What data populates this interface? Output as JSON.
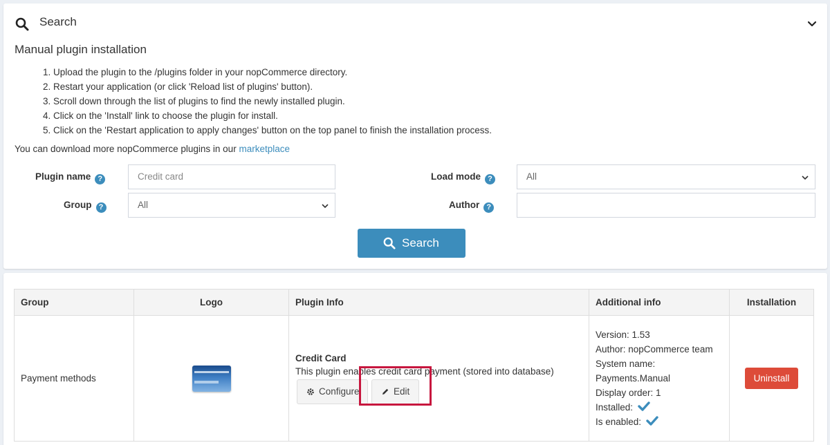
{
  "search_panel": {
    "title": "Search",
    "manual_title": "Manual plugin installation",
    "steps": [
      "1. Upload the plugin to the /plugins folder in your nopCommerce directory.",
      "2. Restart your application (or click 'Reload list of plugins' button).",
      "3. Scroll down through the list of plugins to find the newly installed plugin.",
      "4. Click on the 'Install' link to choose the plugin for install.",
      "5. Click on the 'Restart application to apply changes' button on the top panel to finish the installation process."
    ],
    "download_text": "You can download more nopCommerce plugins in our ",
    "download_link": "marketplace",
    "fields": {
      "plugin_name_label": "Plugin name",
      "plugin_name_placeholder": "Credit card",
      "group_label": "Group",
      "group_value": "All",
      "load_mode_label": "Load mode",
      "load_mode_value": "All",
      "author_label": "Author",
      "author_value": ""
    },
    "search_button": "Search"
  },
  "table": {
    "headers": [
      "Group",
      "Logo",
      "Plugin Info",
      "Additional info",
      "Installation"
    ],
    "row": {
      "group": "Payment methods",
      "plugin_name": "Credit Card",
      "plugin_desc": "This plugin enables credit card payment (stored into database)",
      "configure_button": "Configure",
      "edit_button": "Edit",
      "version": "Version: 1.53",
      "author": "Author: nopCommerce team",
      "system_name_label": "System name:",
      "system_name": "Payments.Manual",
      "display_order": "Display order: 1",
      "installed": "Installed:",
      "is_enabled": "Is enabled:",
      "uninstall_button": "Uninstall"
    }
  },
  "colors": {
    "accent": "#3c8dbc",
    "danger": "#dd4b39",
    "highlight": "#c7163e"
  }
}
